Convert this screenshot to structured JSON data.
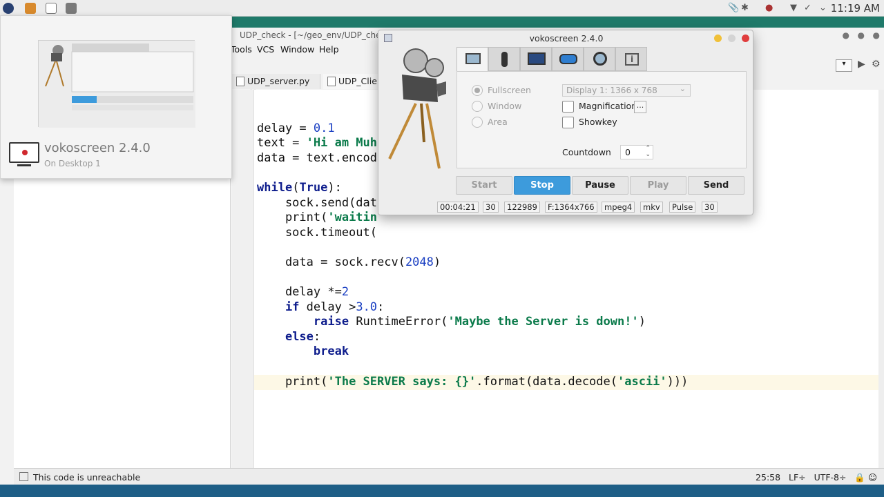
{
  "topbar": {
    "clock": "11:19 AM",
    "icons": [
      "fedora-icon",
      "vokoscreen-launcher-icon",
      "window-switcher-icon",
      "terminal-icon"
    ],
    "tray": [
      "attachment-icon",
      "bluetooth-icon",
      "record-indicator-icon",
      "wifi-icon",
      "network-check-icon",
      "chevron-down-icon"
    ]
  },
  "ide": {
    "title": "UDP_check - [~/geo_env/UDP_check",
    "menus": [
      "Tools",
      "VCS",
      "Window",
      "Help"
    ],
    "tabs": [
      {
        "label": "UDP_server.py",
        "active": false
      },
      {
        "label": "UDP_Clien",
        "active": true
      }
    ],
    "code_lines": [
      "delay = 0.1",
      "text = 'Hi am Muh",
      "data = text.encod",
      "",
      "while(True):",
      "    sock.send(dat",
      "    print('waitin",
      "    sock.timeout(",
      "",
      "    data = sock.recv(2048)",
      "",
      "    delay *=2",
      "    if delay >3.0:",
      "        raise RuntimeError('Maybe the Server is down!')",
      "    else:",
      "        break",
      "",
      "    print('The SERVER says: {}'.format(data.decode('ascii')))"
    ],
    "status": {
      "message": "This code is unreachable",
      "position": "25:58",
      "line_ending": "LF÷",
      "encoding": "UTF-8÷"
    }
  },
  "vokoscreen": {
    "title": "vokoscreen 2.4.0",
    "tabs": [
      "screen-tab-icon",
      "microphone-tab-icon",
      "video-settings-tab-icon",
      "toggle-tab-icon",
      "webcam-tab-icon",
      "info-tab-icon"
    ],
    "area_options": [
      "Fullscreen",
      "Window",
      "Area"
    ],
    "display_select": "Display 1:  1366 x 768",
    "magnification_label": "Magnification",
    "magnification_btn": "...",
    "showkey_label": "Showkey",
    "countdown_label": "Countdown",
    "countdown_value": "0",
    "buttons": {
      "start": "Start",
      "stop": "Stop",
      "pause": "Pause",
      "play": "Play",
      "send": "Send"
    },
    "stats": [
      "00:04:21",
      "30",
      "122989",
      "F:1364x766",
      "mpeg4",
      "mkv",
      "Pulse",
      "30"
    ],
    "accent": "#3d9bdc"
  },
  "preview": {
    "title": "vokoscreen 2.4.0",
    "subtitle": "On Desktop 1"
  }
}
